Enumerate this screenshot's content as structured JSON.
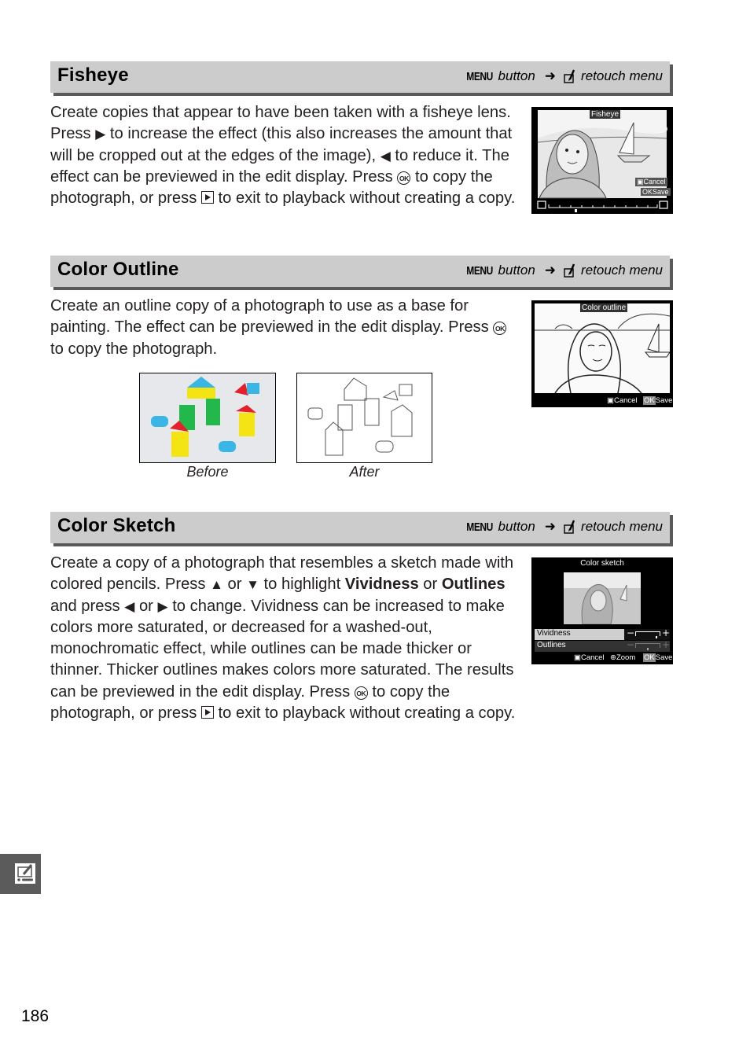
{
  "page": {
    "number": "186"
  },
  "nav_path": {
    "menu_key": "MENU",
    "button_label": "button",
    "arrow": "➜",
    "menu_label": "retouch menu",
    "icon": "retouch-menu-icon"
  },
  "sections": [
    {
      "title": "Fisheye",
      "text_parts": {
        "p1": "Create copies that appear to have been taken with a fisheye lens.  Press",
        "right_glyph": "▶",
        "p2": "to increase the effect (this also increases the amount that will be cropped out at the edges of the image),",
        "left_glyph": "◀",
        "p3": "to reduce it.  The effect can be previewed in the edit display. Press",
        "ok_glyph": "OK",
        "p4": "to copy the photograph, or press",
        "p5": "to exit to playback without creating a copy."
      },
      "screen": {
        "title": "Fisheye",
        "cancel": "Cancel",
        "save": "Save",
        "ok_key": "OK",
        "slider_value_fraction": 0.25
      }
    },
    {
      "title": "Color Outline",
      "text_parts": {
        "p1": "Create an outline copy of a photograph to use as a base for painting.  The effect can be previewed in the edit display.  Press",
        "ok_glyph": "OK",
        "p2": "to copy the photograph."
      },
      "screen": {
        "title": "Color outline",
        "cancel": "Cancel",
        "save": "Save",
        "ok_key": "OK"
      },
      "examples": [
        {
          "caption": "Before"
        },
        {
          "caption": "After"
        }
      ]
    },
    {
      "title": "Color Sketch",
      "text_parts": {
        "p1": "Create a copy of a photograph that resembles a sketch made with colored pencils.  Press",
        "up_glyph": "▲",
        "or1": "or",
        "down_glyph": "▼",
        "p2": "to highlight",
        "bold1": "Vividness",
        "or2": "or",
        "bold2": "Outlines",
        "p3": "and press",
        "left_glyph": "◀",
        "or3": "or",
        "right_glyph": "▶",
        "p4": "to change.  Vividness can be increased to make colors more saturated, or decreased for a washed-out, monochromatic effect, while outlines can be made thicker or thinner.  Thicker outlines makes colors more saturated.  The results can be previewed in the edit display. Press",
        "ok_glyph": "OK",
        "p5": "to copy the photograph, or press",
        "p6": "to exit to playback without creating a copy."
      },
      "screen": {
        "title": "Color sketch",
        "rows": [
          {
            "label": "Vividness",
            "minus": "−",
            "plus": "+",
            "value_fraction": 0.85
          },
          {
            "label": "Outlines",
            "minus": "−",
            "plus": "+",
            "value_fraction": 0.5
          }
        ],
        "cancel": "Cancel",
        "zoom": "Zoom",
        "save": "Save",
        "ok_key": "OK"
      }
    }
  ]
}
